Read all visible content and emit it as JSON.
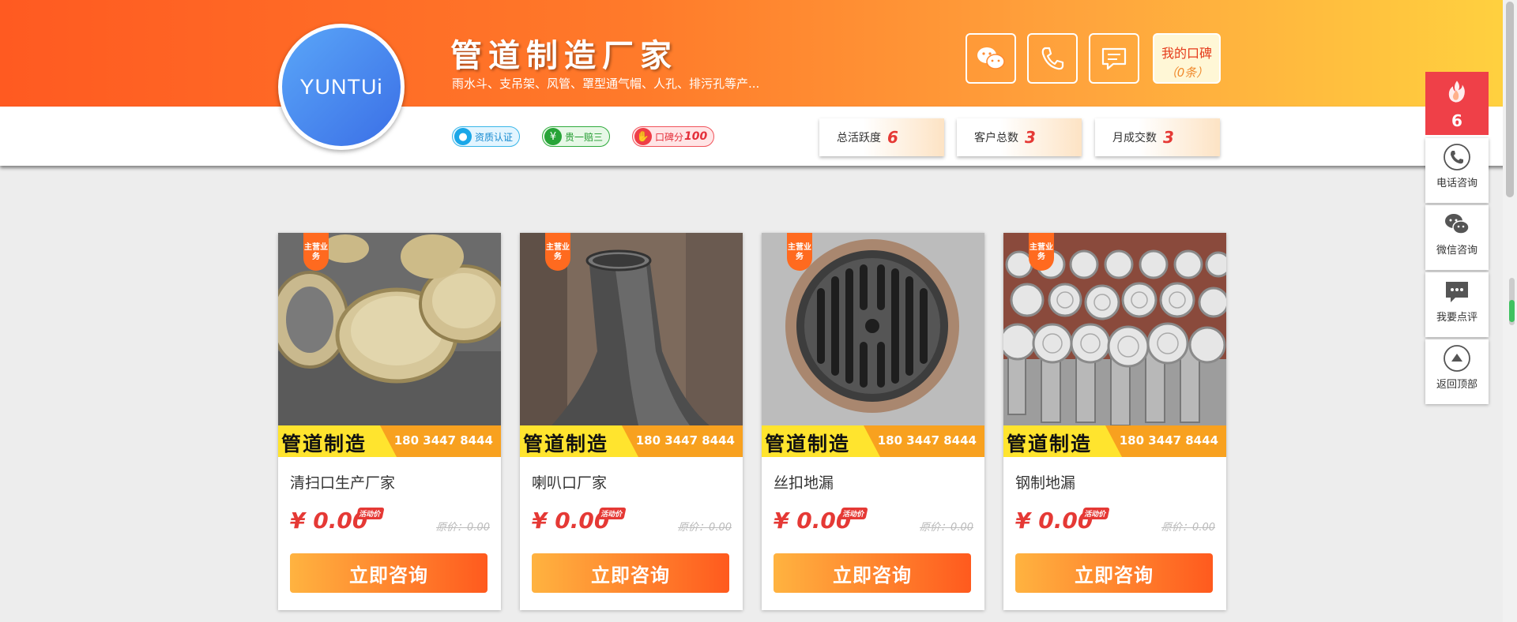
{
  "header": {
    "logo_text": "YUNTUi",
    "title": "管道制造厂家",
    "subtitle": "雨水斗、支吊架、风管、罩型通气帽、人孔、排污孔等产...",
    "koubei_label": "我的口碑",
    "koubei_count": "（0条）",
    "badges": [
      {
        "icon": "user-icon",
        "label": "资质认证"
      },
      {
        "icon": "yuan-icon",
        "label": "贵一赔三"
      },
      {
        "icon": "thumb-icon",
        "label": "口碑分",
        "value": "100"
      }
    ],
    "stats": [
      {
        "label": "总活跃度",
        "value": "6"
      },
      {
        "label": "客户总数",
        "value": "3"
      },
      {
        "label": "月成交数",
        "value": "3"
      }
    ],
    "contact_icons": [
      "wechat-icon",
      "phone-icon",
      "message-icon"
    ]
  },
  "products": [
    {
      "tag": "主营业务",
      "strip_title": "管道制造",
      "strip_phone": "180 3447 8444",
      "name": "清扫口生产厂家",
      "price": "¥ 0.00",
      "price_tag": "活动价",
      "orig_price": "原价：0.00",
      "button": "立即咨询"
    },
    {
      "tag": "主营业务",
      "strip_title": "管道制造",
      "strip_phone": "180 3447 8444",
      "name": "喇叭口厂家",
      "price": "¥ 0.00",
      "price_tag": "活动价",
      "orig_price": "原价：0.00",
      "button": "立即咨询"
    },
    {
      "tag": "主营业务",
      "strip_title": "管道制造",
      "strip_phone": "180 3447 8444",
      "name": "丝扣地漏",
      "price": "¥ 0.00",
      "price_tag": "活动价",
      "orig_price": "原价：0.00",
      "button": "立即咨询"
    },
    {
      "tag": "主营业务",
      "strip_title": "管道制造",
      "strip_phone": "180 3447 8444",
      "name": "钢制地漏",
      "price": "¥ 0.00",
      "price_tag": "活动价",
      "orig_price": "原价：0.00",
      "button": "立即咨询"
    }
  ],
  "sidebar": {
    "hot_value": "6",
    "items": [
      {
        "icon": "phone-icon",
        "label": "电话咨询"
      },
      {
        "icon": "wechat-icon",
        "label": "微信咨询"
      },
      {
        "icon": "comment-icon",
        "label": "我要点评"
      },
      {
        "icon": "arrow-up-icon",
        "label": "返回顶部"
      }
    ]
  },
  "colors": {
    "banner_start": "#ff5a21",
    "banner_end": "#ffd23f",
    "accent_red": "#e53935",
    "button_start": "#ffb340",
    "button_end": "#ff5a1e",
    "strip_yellow": "#ffe42e",
    "strip_orange": "#f8a11f"
  }
}
